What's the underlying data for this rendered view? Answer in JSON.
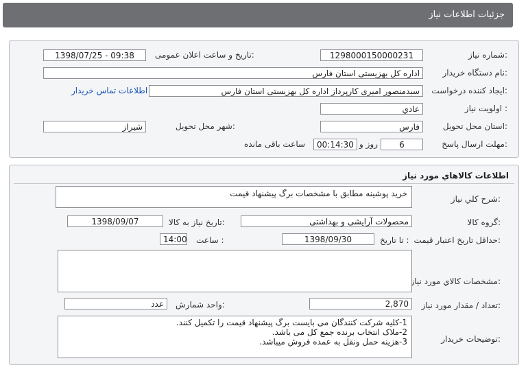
{
  "header": {
    "title": "جزئيات اطلاعات نياز"
  },
  "info": {
    "need_number_label": "شماره نياز:",
    "need_number": "1298000150000231",
    "announce_label": "تاريخ و ساعت اعلان عمومی:",
    "announce_value": "1398/07/25 - 09:38",
    "buyer_org_label": "نام دستگاه خريدار:",
    "buyer_org": "اداره کل بهزیستی استان فارس",
    "creator_label": "ايجاد کننده درخواست:",
    "creator": "سیدمنصور امیری کارپرداز اداره کل بهزیستی استان فارس",
    "contact_link": "اطلاعات تماس خريدار",
    "priority_label": "اولويت نياز :",
    "priority": "عادي",
    "province_label": "استان محل تحويل:",
    "province": "فارس",
    "city_label": "شهر محل تحويل:",
    "city": "شیراز",
    "deadline_label": "مهلت ارسال پاسخ:",
    "days": "6",
    "days_label": "روز و",
    "time": "00:14:30",
    "time_label": "ساعت باقی مانده"
  },
  "goods": {
    "section_title": "اطلاعات کالاهاي مورد نياز",
    "desc_label": "شرح کلي نياز:",
    "desc": "خرید پوشینه مطابق با مشخصات برگ پیشنهاد قیمت",
    "group_label": "گروه کالا:",
    "group": "محصولات آرایشی و بهداشتی",
    "need_date_label": "تاريخ نياز به کالا:",
    "need_date": "1398/09/07",
    "validity_label": "حداقل تاريخ اعتبار قيمت:",
    "until_date_label": "تا تاريخ :",
    "until_date": "1398/09/30",
    "hour_label": "ساعت :",
    "hour": "14:00",
    "spec_label": "مشخصات کالاي مورد نياز:",
    "qty_label": "تعداد / مقدار مورد نياز:",
    "qty": "2,870",
    "unit_label": "واحد شمارش:",
    "unit": "عدد",
    "buyer_notes_label": "توضيحات خريدار:",
    "notes": [
      "1-کلیه شرکت کنندگان می بایست برگ پیشنهاد قیمت را تکمیل کنند.",
      "2-ملاک انتخاب برنده جمع کل می باشد.",
      "3-هزینه حمل ونقل به عمده فروش میباشد."
    ]
  }
}
